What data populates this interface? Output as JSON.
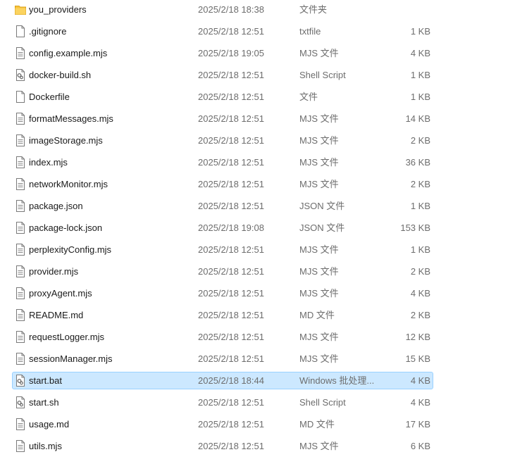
{
  "colors": {
    "selected_bg": "#cce8ff",
    "selected_border": "#99d1ff",
    "folder_icon": "#f8c33b",
    "secondary_text": "#6d6d6d"
  },
  "files": [
    {
      "name": "you_providers",
      "modified": "2025/2/18 18:38",
      "type": "文件夹",
      "size": "",
      "icon": "folder-icon",
      "selected": false
    },
    {
      "name": ".gitignore",
      "modified": "2025/2/18 12:51",
      "type": "txtfile",
      "size": "1 KB",
      "icon": "blank-file-icon",
      "selected": false
    },
    {
      "name": "config.example.mjs",
      "modified": "2025/2/18 19:05",
      "type": "MJS 文件",
      "size": "4 KB",
      "icon": "text-file-icon",
      "selected": false
    },
    {
      "name": "docker-build.sh",
      "modified": "2025/2/18 12:51",
      "type": "Shell Script",
      "size": "1 KB",
      "icon": "script-file-icon",
      "selected": false
    },
    {
      "name": "Dockerfile",
      "modified": "2025/2/18 12:51",
      "type": "文件",
      "size": "1 KB",
      "icon": "blank-file-icon",
      "selected": false
    },
    {
      "name": "formatMessages.mjs",
      "modified": "2025/2/18 12:51",
      "type": "MJS 文件",
      "size": "14 KB",
      "icon": "text-file-icon",
      "selected": false
    },
    {
      "name": "imageStorage.mjs",
      "modified": "2025/2/18 12:51",
      "type": "MJS 文件",
      "size": "2 KB",
      "icon": "text-file-icon",
      "selected": false
    },
    {
      "name": "index.mjs",
      "modified": "2025/2/18 12:51",
      "type": "MJS 文件",
      "size": "36 KB",
      "icon": "text-file-icon",
      "selected": false
    },
    {
      "name": "networkMonitor.mjs",
      "modified": "2025/2/18 12:51",
      "type": "MJS 文件",
      "size": "2 KB",
      "icon": "text-file-icon",
      "selected": false
    },
    {
      "name": "package.json",
      "modified": "2025/2/18 12:51",
      "type": "JSON 文件",
      "size": "1 KB",
      "icon": "text-file-icon",
      "selected": false
    },
    {
      "name": "package-lock.json",
      "modified": "2025/2/18 19:08",
      "type": "JSON 文件",
      "size": "153 KB",
      "icon": "text-file-icon",
      "selected": false
    },
    {
      "name": "perplexityConfig.mjs",
      "modified": "2025/2/18 12:51",
      "type": "MJS 文件",
      "size": "1 KB",
      "icon": "text-file-icon",
      "selected": false
    },
    {
      "name": "provider.mjs",
      "modified": "2025/2/18 12:51",
      "type": "MJS 文件",
      "size": "2 KB",
      "icon": "text-file-icon",
      "selected": false
    },
    {
      "name": "proxyAgent.mjs",
      "modified": "2025/2/18 12:51",
      "type": "MJS 文件",
      "size": "4 KB",
      "icon": "text-file-icon",
      "selected": false
    },
    {
      "name": "README.md",
      "modified": "2025/2/18 12:51",
      "type": "MD 文件",
      "size": "2 KB",
      "icon": "text-file-icon",
      "selected": false
    },
    {
      "name": "requestLogger.mjs",
      "modified": "2025/2/18 12:51",
      "type": "MJS 文件",
      "size": "12 KB",
      "icon": "text-file-icon",
      "selected": false
    },
    {
      "name": "sessionManager.mjs",
      "modified": "2025/2/18 12:51",
      "type": "MJS 文件",
      "size": "15 KB",
      "icon": "text-file-icon",
      "selected": false
    },
    {
      "name": "start.bat",
      "modified": "2025/2/18 18:44",
      "type": "Windows 批处理...",
      "size": "4 KB",
      "icon": "script-file-icon",
      "selected": true
    },
    {
      "name": "start.sh",
      "modified": "2025/2/18 12:51",
      "type": "Shell Script",
      "size": "4 KB",
      "icon": "script-file-icon",
      "selected": false
    },
    {
      "name": "usage.md",
      "modified": "2025/2/18 12:51",
      "type": "MD 文件",
      "size": "17 KB",
      "icon": "text-file-icon",
      "selected": false
    },
    {
      "name": "utils.mjs",
      "modified": "2025/2/18 12:51",
      "type": "MJS 文件",
      "size": "6 KB",
      "icon": "text-file-icon",
      "selected": false
    }
  ]
}
